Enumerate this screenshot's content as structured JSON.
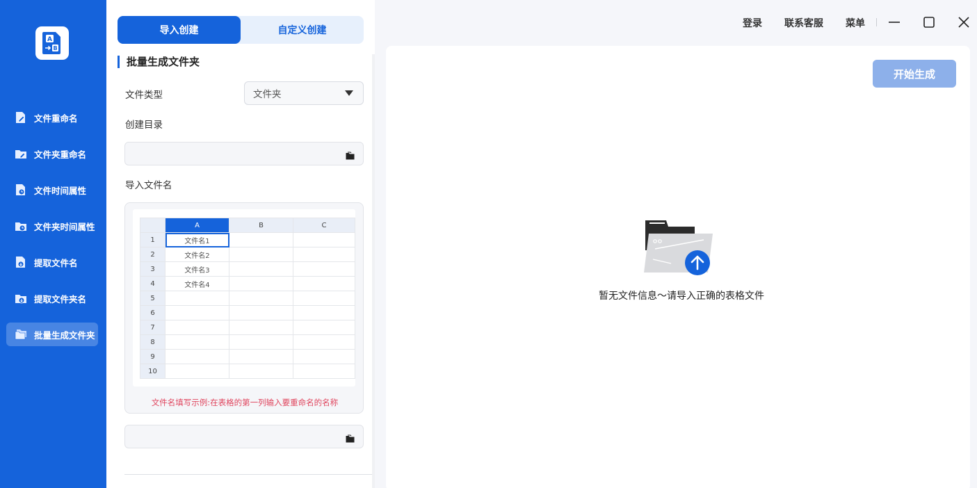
{
  "sidebar": {
    "items": [
      {
        "label": "文件重命名",
        "icon": "file-edit-icon"
      },
      {
        "label": "文件夹重命名",
        "icon": "folder-edit-icon"
      },
      {
        "label": "文件时间属性",
        "icon": "file-clock-icon"
      },
      {
        "label": "文件夹时间属性",
        "icon": "folder-clock-icon"
      },
      {
        "label": "提取文件名",
        "icon": "file-extract-icon"
      },
      {
        "label": "提取文件夹名",
        "icon": "folder-extract-icon"
      },
      {
        "label": "批量生成文件夹",
        "icon": "folders-icon",
        "active": true
      }
    ]
  },
  "panel": {
    "tabs": [
      {
        "label": "导入创建",
        "active": true
      },
      {
        "label": "自定义创建",
        "active": false
      }
    ],
    "section_title": "批量生成文件夹",
    "file_type_label": "文件类型",
    "file_type_value": "文件夹",
    "create_dir_label": "创建目录",
    "import_label": "导入文件名",
    "sheet": {
      "columns": [
        "A",
        "B",
        "C"
      ],
      "rows": [
        {
          "n": "1",
          "a": "文件名1"
        },
        {
          "n": "2",
          "a": "文件名2"
        },
        {
          "n": "3",
          "a": "文件名3"
        },
        {
          "n": "4",
          "a": "文件名4"
        },
        {
          "n": "5",
          "a": ""
        },
        {
          "n": "6",
          "a": ""
        },
        {
          "n": "7",
          "a": ""
        },
        {
          "n": "8",
          "a": ""
        },
        {
          "n": "9",
          "a": ""
        },
        {
          "n": "10",
          "a": ""
        }
      ]
    },
    "hint": "文件名填写示例:在表格的第一列输入要重命名的名称"
  },
  "topbar": {
    "login": "登录",
    "support": "联系客服",
    "menu": "菜单"
  },
  "content": {
    "start_button": "开始生成",
    "empty_message": "暂无文件信息～请导入正确的表格文件"
  },
  "colors": {
    "brand": "#1563db",
    "button_disabled": "#8db0ea",
    "hint": "#e0455e"
  }
}
